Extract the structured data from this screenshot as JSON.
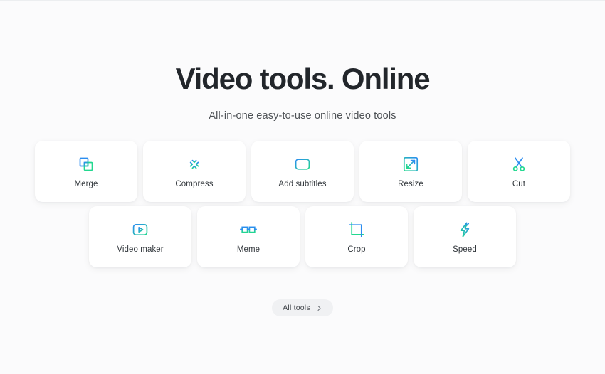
{
  "hero": {
    "title": "Video tools. Online",
    "subtitle": "All-in-one easy-to-use online video tools"
  },
  "theme": {
    "background": "#fbfbfc",
    "card_background": "#ffffff",
    "title_color": "#22262b",
    "label_color": "#33383d",
    "gradient_start": "#2b8df0",
    "gradient_mid": "#1cb4d4",
    "gradient_end": "#22d88f"
  },
  "tools": {
    "row_1": [
      {
        "label": "Merge",
        "icon": "merge-icon"
      },
      {
        "label": "Compress",
        "icon": "compress-icon"
      },
      {
        "label": "Add subtitles",
        "icon": "subtitles-icon"
      },
      {
        "label": "Resize",
        "icon": "resize-icon"
      },
      {
        "label": "Cut",
        "icon": "scissors-icon"
      }
    ],
    "row_2": [
      {
        "label": "Video maker",
        "icon": "play-icon"
      },
      {
        "label": "Meme",
        "icon": "glasses-icon"
      },
      {
        "label": "Crop",
        "icon": "crop-icon"
      },
      {
        "label": "Speed",
        "icon": "lightning-icon"
      }
    ]
  },
  "all_tools_button": {
    "label": "All tools",
    "icon": "chevron-right-icon"
  }
}
